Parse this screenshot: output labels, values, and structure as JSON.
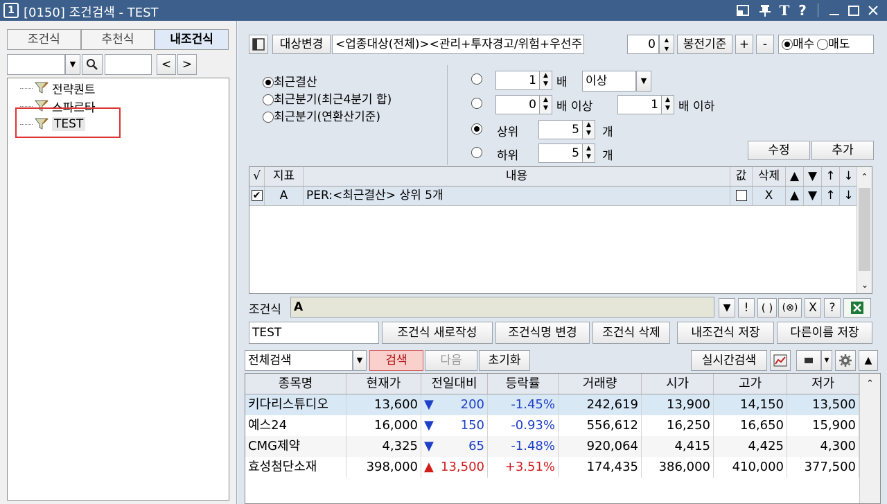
{
  "window": {
    "num": "1",
    "title": "[0150] 조건검색 - TEST"
  },
  "left": {
    "tabs": [
      "조건식",
      "추천식",
      "내조건식"
    ],
    "tree": [
      "전략퀀트",
      "스파르타",
      "TEST"
    ]
  },
  "top": {
    "target_btn": "대상변경",
    "target_desc": "<업종대상(전체)><관리+투자경고/위험+우선주+",
    "target_num": "0",
    "candle_btn": "봉전기준",
    "plus": "+",
    "minus": "-",
    "buy": "매수",
    "sell": "매도"
  },
  "options": {
    "r1": "최근결산",
    "r2": "최근분기(최근4분기 합)",
    "r3": "최근분기(연환산기준)",
    "mult_val": "1",
    "mult_label": "배",
    "dropdown": "이상",
    "lo_val": "0",
    "lo_label": "배 이상",
    "hi_val": "1",
    "hi_label": "배 이하",
    "top_label": "상위",
    "top_val": "5",
    "top_unit": "개",
    "bot_label": "하위",
    "bot_val": "5",
    "bot_unit": "개",
    "edit_btn": "수정",
    "add_btn": "추가"
  },
  "cond_grid": {
    "headers": [
      "√",
      "지표",
      "내용",
      "값",
      "삭제",
      "▲",
      "▼",
      "↑",
      "↓"
    ],
    "row": {
      "check": "✔",
      "id": "A",
      "content": "PER:<최근결산> 상위 5개",
      "del": "X",
      "up": "▲",
      "down": "▼",
      "top": "↑",
      "bottom": "↓"
    }
  },
  "formula": {
    "label": "조건식",
    "value": "A",
    "ops": [
      "▼",
      "!",
      "( )",
      "(⊗)",
      "X",
      "?"
    ]
  },
  "name_row": {
    "name": "TEST",
    "new_btn": "조건식 새로작성",
    "rename_btn": "조건식명 변경",
    "delete_btn": "조건식 삭제",
    "save_btn": "내조건식 저장",
    "saveas_btn": "다른이름 저장"
  },
  "search_bar": {
    "mode": "전체검색",
    "search_btn": "검색",
    "next_btn": "다음",
    "reset_btn": "초기화",
    "realtime_btn": "실시간검색"
  },
  "results": {
    "headers": [
      "종목명",
      "현재가",
      "전일대비",
      "등락률",
      "거래량",
      "시가",
      "고가",
      "저가"
    ],
    "rows": [
      {
        "name": "키다리스튜디오",
        "price": "13,600",
        "dir": "down",
        "arrow": "▼",
        "chg": "200",
        "rate": "-1.45%",
        "vol": "242,619",
        "open": "13,900",
        "high": "14,150",
        "low": "13,500"
      },
      {
        "name": "예스24",
        "price": "16,000",
        "dir": "down",
        "arrow": "▼",
        "chg": "150",
        "rate": "-0.93%",
        "vol": "556,612",
        "open": "16,250",
        "high": "16,650",
        "low": "15,900"
      },
      {
        "name": "CMG제약",
        "price": "4,325",
        "dir": "down",
        "arrow": "▼",
        "chg": "65",
        "rate": "-1.48%",
        "vol": "920,064",
        "open": "4,415",
        "high": "4,425",
        "low": "4,300"
      },
      {
        "name": "효성첨단소재",
        "price": "398,000",
        "dir": "up",
        "arrow": "▲",
        "chg": "13,500",
        "rate": "+3.51%",
        "vol": "174,435",
        "open": "386,000",
        "high": "410,000",
        "low": "377,500"
      }
    ]
  },
  "colors": {
    "title_bg": "#3c5f8c",
    "highlight": "#d33",
    "up": "#d21b1b",
    "down": "#1e40c8"
  }
}
